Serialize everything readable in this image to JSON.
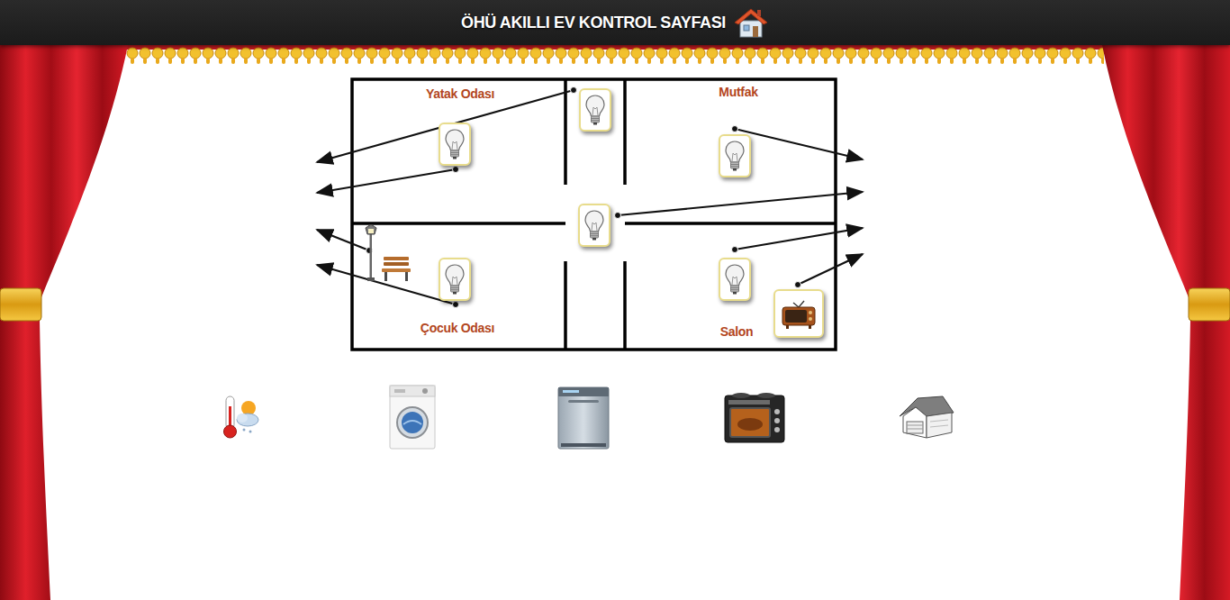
{
  "header": {
    "title": "ÖHÜ AKILLI EV KONTROL SAYFASI"
  },
  "rooms": [
    {
      "name": "Yatak Odası"
    },
    {
      "name": "Mutfak"
    },
    {
      "name": "Çocuk Odası"
    },
    {
      "name": "Salon"
    }
  ],
  "devices": [
    {
      "kind": "bulb",
      "on": false
    },
    {
      "kind": "bulb",
      "on": false
    },
    {
      "kind": "bulb",
      "on": false
    },
    {
      "kind": "bulb",
      "on": false
    },
    {
      "kind": "bulb",
      "on": false
    },
    {
      "kind": "bulb",
      "on": false
    },
    {
      "kind": "lamp"
    },
    {
      "kind": "tv"
    }
  ],
  "appliances": [
    {
      "kind": "weather"
    },
    {
      "kind": "washer"
    },
    {
      "kind": "dishwasher"
    },
    {
      "kind": "oven"
    },
    {
      "kind": "garage"
    }
  ]
}
